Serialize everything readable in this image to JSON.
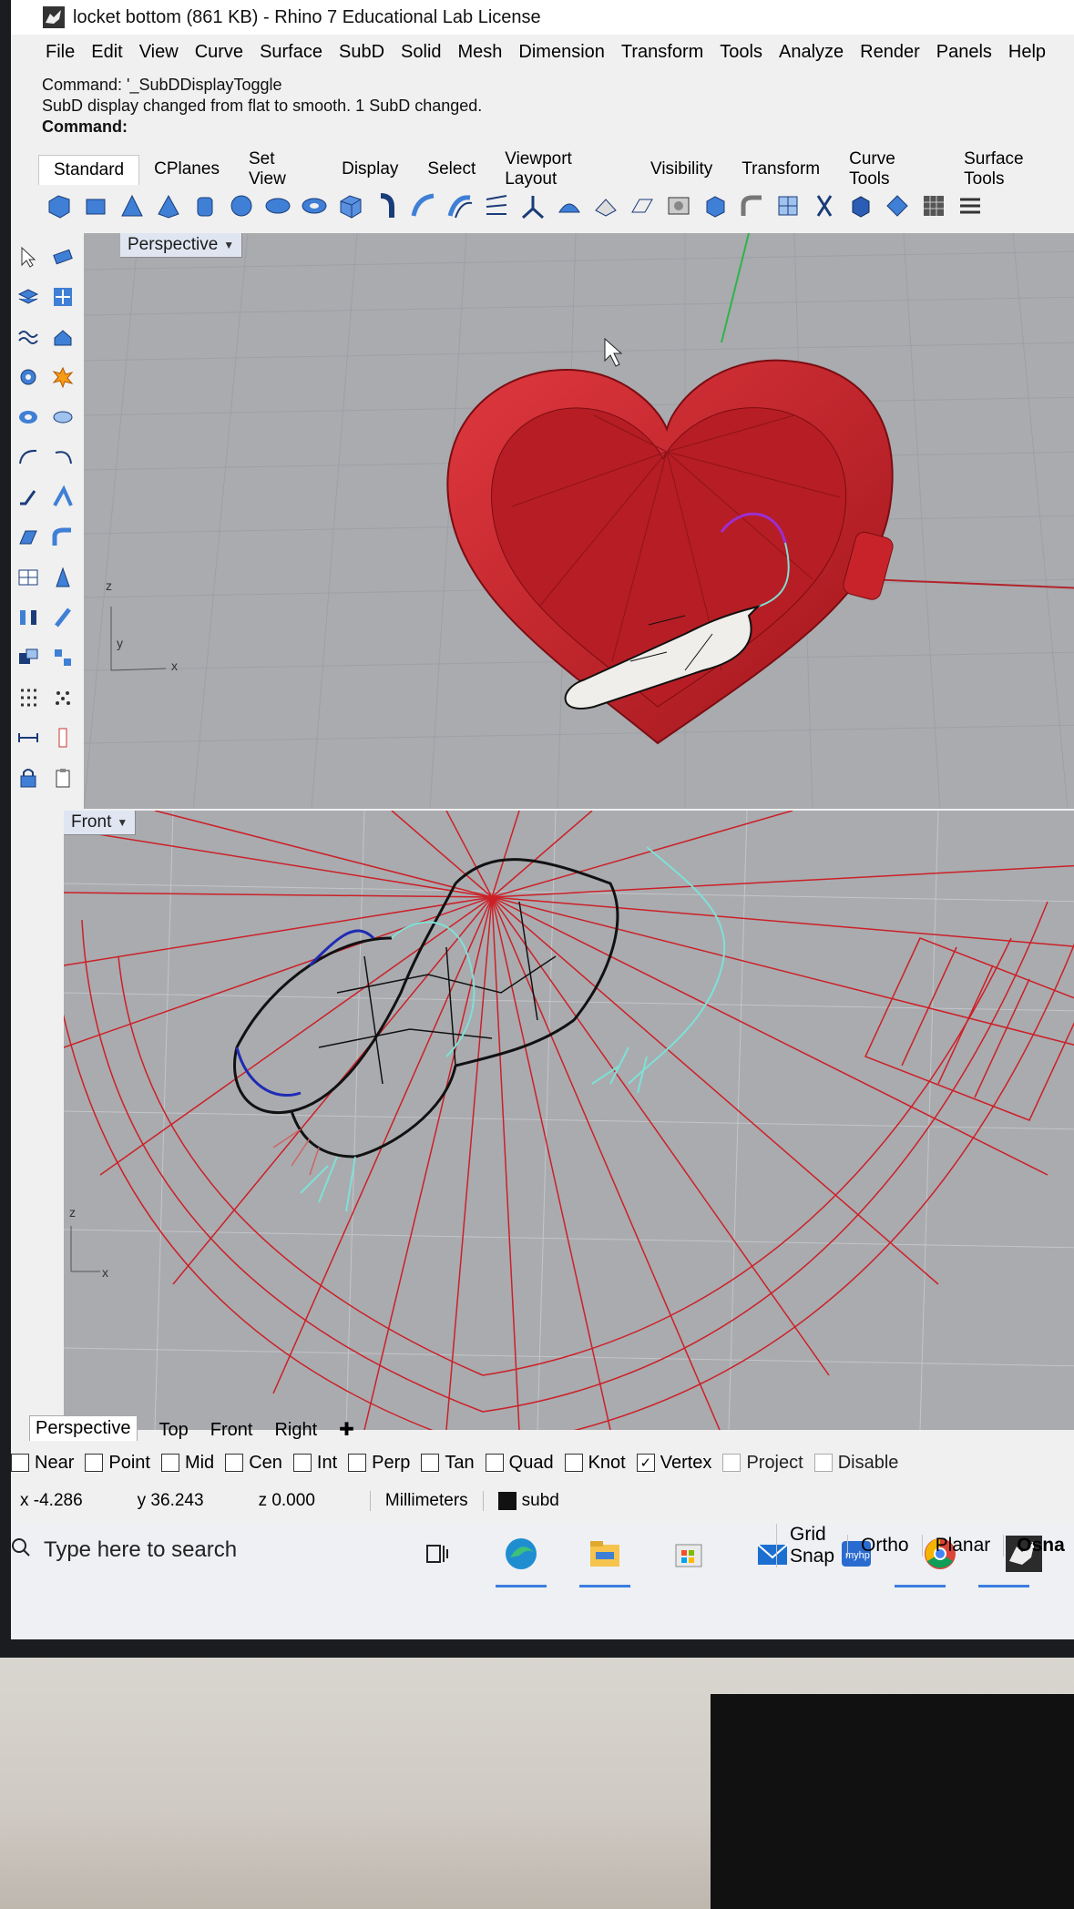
{
  "window": {
    "title": "locket bottom (861 KB) - Rhino 7 Educational Lab License"
  },
  "menus": [
    "File",
    "Edit",
    "View",
    "Curve",
    "Surface",
    "SubD",
    "Solid",
    "Mesh",
    "Dimension",
    "Transform",
    "Tools",
    "Analyze",
    "Render",
    "Panels",
    "Help"
  ],
  "command_history": [
    "Command: '_SubDDisplayToggle",
    "SubD display changed from flat to smooth. 1 SubD changed."
  ],
  "command_prompt": "Command:",
  "toolbar_tabs": [
    "Standard",
    "CPlanes",
    "Set View",
    "Display",
    "Select",
    "Viewport Layout",
    "Visibility",
    "Transform",
    "Curve Tools",
    "Surface Tools"
  ],
  "viewports": {
    "top": {
      "label": "Perspective",
      "axes": {
        "z": "z",
        "y": "y",
        "x": "x"
      }
    },
    "bottom": {
      "label": "Front",
      "axes": {
        "z": "z",
        "x": "x"
      }
    }
  },
  "viewport_tabs": [
    "Perspective",
    "Top",
    "Front",
    "Right"
  ],
  "osnaps": [
    {
      "label": "Near",
      "checked": false
    },
    {
      "label": "Point",
      "checked": false
    },
    {
      "label": "Mid",
      "checked": false
    },
    {
      "label": "Cen",
      "checked": false
    },
    {
      "label": "Int",
      "checked": false
    },
    {
      "label": "Perp",
      "checked": false
    },
    {
      "label": "Tan",
      "checked": false
    },
    {
      "label": "Quad",
      "checked": false
    },
    {
      "label": "Knot",
      "checked": false
    },
    {
      "label": "Vertex",
      "checked": true
    },
    {
      "label": "Project",
      "checked": false
    },
    {
      "label": "Disable",
      "checked": false
    }
  ],
  "status": {
    "x": "x -4.286",
    "y": "y 36.243",
    "z": "z 0.000",
    "units": "Millimeters",
    "layer": "subd"
  },
  "taskbar": {
    "search_placeholder": "Type here to search",
    "snap_buttons": [
      "Grid Snap",
      "Ortho",
      "Planar",
      "Osna"
    ]
  },
  "colors": {
    "model_red": "#cc2027",
    "viewport_bg": "#a9abaf",
    "rat_outline": "#111111",
    "curve_cyan": "#7fe0d6",
    "curve_purple": "#9b2fd1"
  }
}
